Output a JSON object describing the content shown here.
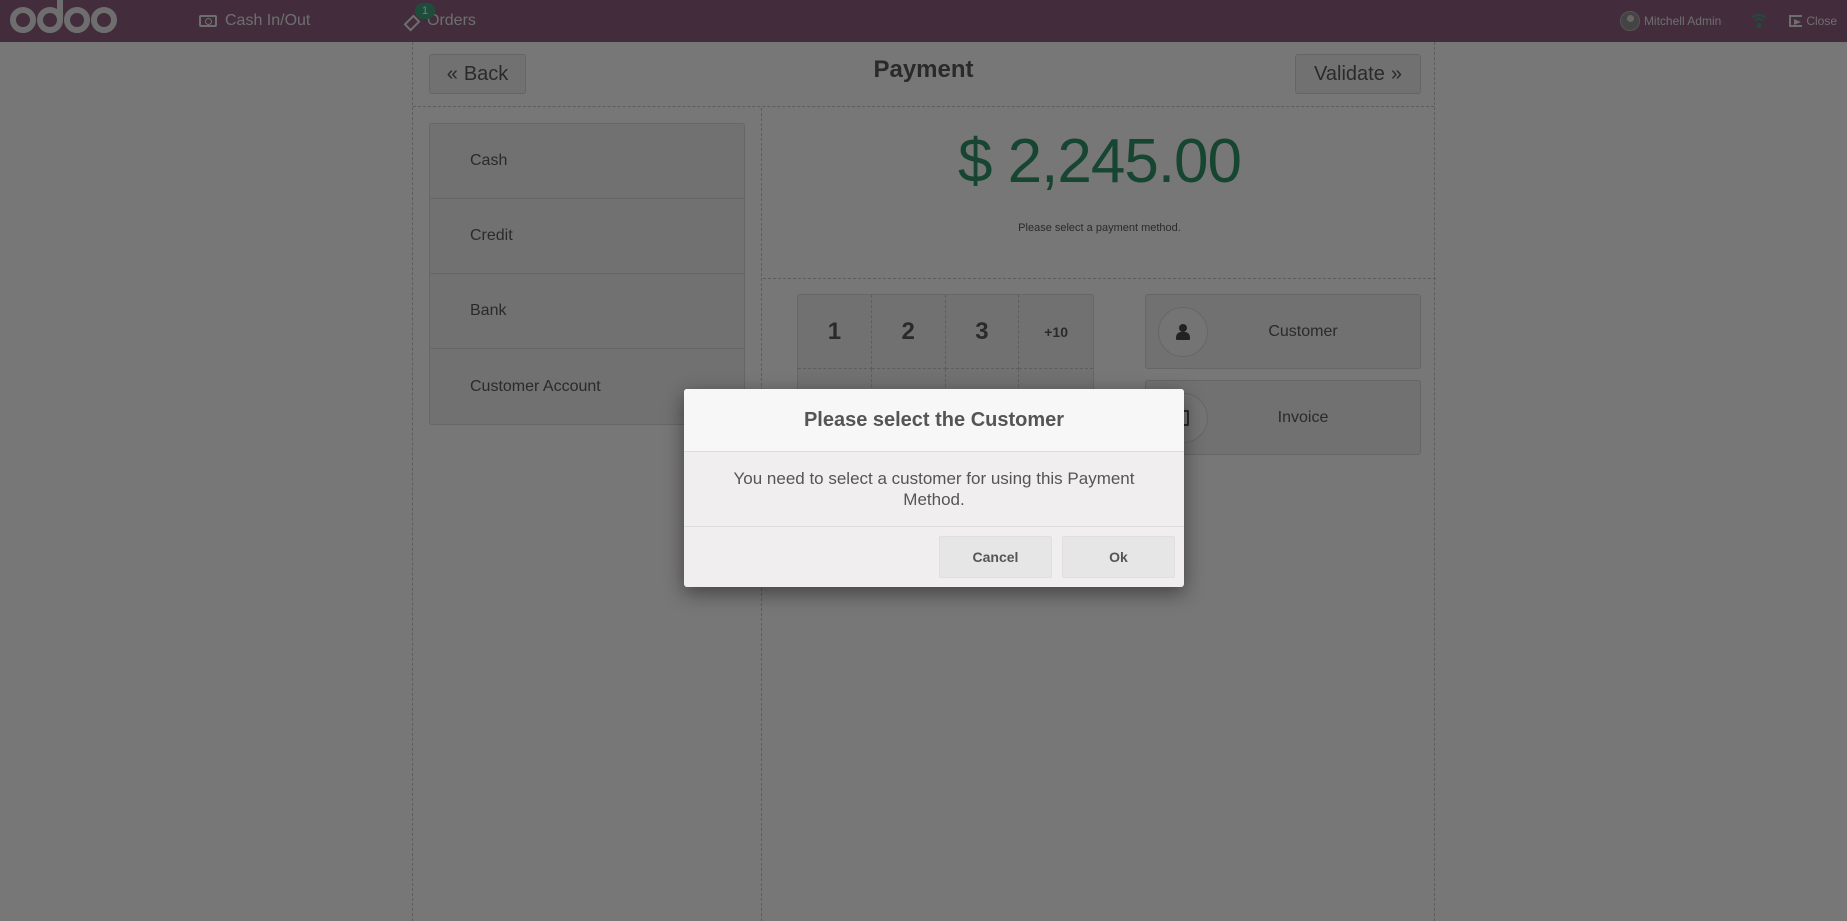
{
  "navbar": {
    "logo_alt": "odoo",
    "cash_in_out_label": "Cash In/Out",
    "orders_label": "Orders",
    "orders_badge": "1",
    "user_name": "Mitchell Admin",
    "close_label": "Close"
  },
  "screen": {
    "title": "Payment",
    "back_label": "Back",
    "validate_label": "Validate",
    "back_glyph": "«",
    "validate_glyph": "»"
  },
  "payment_methods": [
    {
      "label": "Cash"
    },
    {
      "label": "Credit"
    },
    {
      "label": "Bank"
    },
    {
      "label": "Customer Account"
    }
  ],
  "payment_status": {
    "total": "$ 2,245.00",
    "hint": "Please select a payment method."
  },
  "numpad": {
    "keys": [
      "1",
      "2",
      "3",
      "+10"
    ]
  },
  "actions": {
    "customer_label": "Customer",
    "invoice_label": "Invoice"
  },
  "modal": {
    "title": "Please select the Customer",
    "body": "You need to select a customer for using this Payment Method.",
    "cancel_label": "Cancel",
    "ok_label": "Ok"
  },
  "colors": {
    "brand": "#875A7B",
    "total_green": "#2d8a62",
    "badge_green": "#3c9c77"
  }
}
